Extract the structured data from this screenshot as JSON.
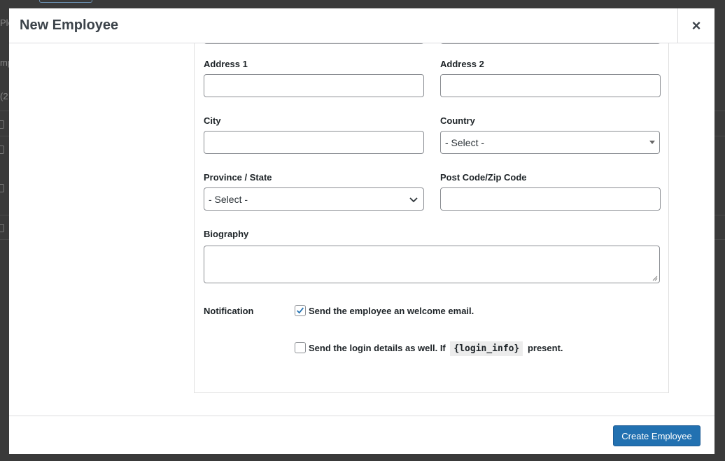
{
  "background": {
    "fragments": [
      "Ple",
      "mp",
      "(2"
    ]
  },
  "modal": {
    "title": "New Employee",
    "close_icon": "×"
  },
  "form": {
    "address1_label": "Address 1",
    "address2_label": "Address 2",
    "city_label": "City",
    "country_label": "Country",
    "country_value": "- Select -",
    "state_label": "Province / State",
    "state_value": "- Select -",
    "postcode_label": "Post Code/Zip Code",
    "biography_label": "Biography",
    "notification_label": "Notification",
    "welcome_email": {
      "label": "Send the employee an welcome email.",
      "checked": true
    },
    "login_details": {
      "label_before": "Send the login details as well. If",
      "token": "{login_info}",
      "label_after": "present.",
      "checked": false
    }
  },
  "footer": {
    "create_label": "Create Employee"
  },
  "colors": {
    "accent": "#2271b1",
    "checkmark": "#2271b1"
  }
}
